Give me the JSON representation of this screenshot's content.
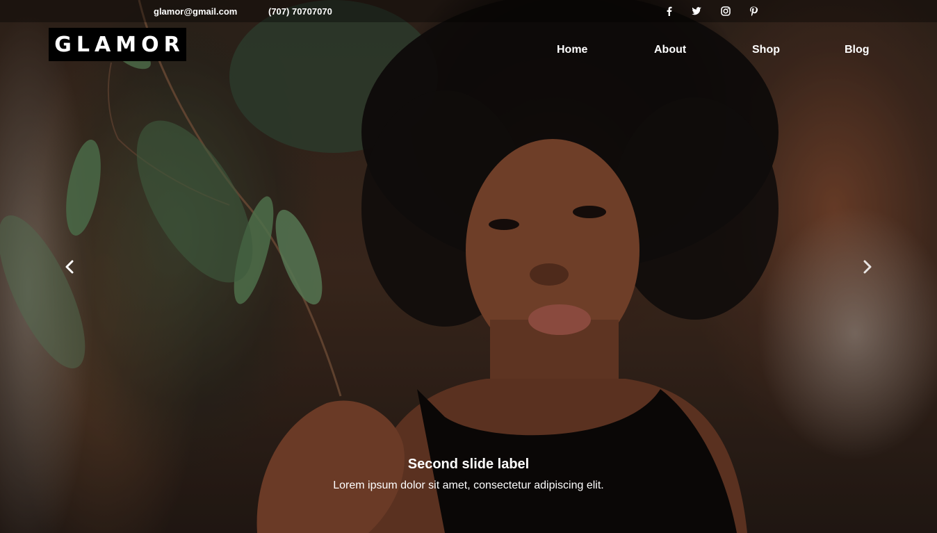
{
  "topbar": {
    "email": "glamor@gmail.com",
    "phone": "(707) 70707070",
    "social": [
      {
        "icon": "facebook-icon"
      },
      {
        "icon": "twitter-icon"
      },
      {
        "icon": "instagram-icon"
      },
      {
        "icon": "pinterest-icon"
      }
    ]
  },
  "logo": {
    "text": "GLAMOR"
  },
  "nav": {
    "items": [
      {
        "label": "Home"
      },
      {
        "label": "About"
      },
      {
        "label": "Shop"
      },
      {
        "label": "Blog"
      }
    ]
  },
  "carousel": {
    "prev_icon": "chevron-left-icon",
    "next_icon": "chevron-right-icon",
    "caption_title": "Second slide label",
    "caption_text": "Lorem ipsum dolor sit amet, consectetur adipiscing elit."
  }
}
